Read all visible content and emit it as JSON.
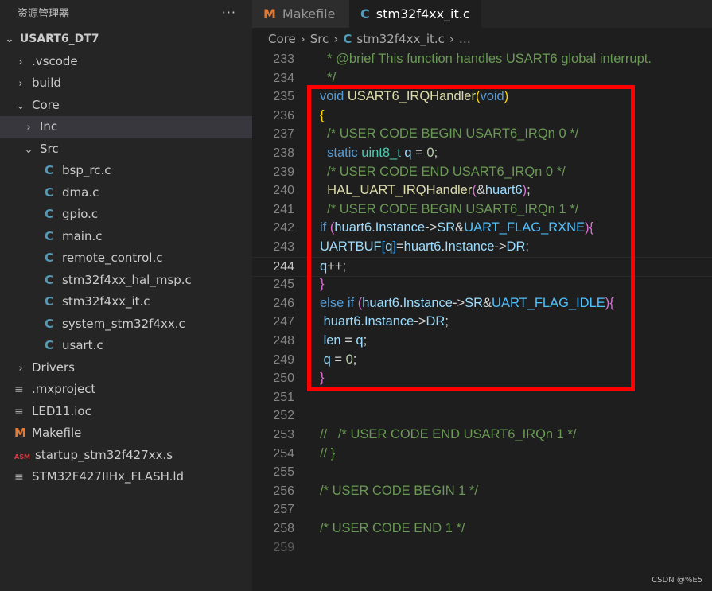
{
  "explorer": {
    "title": "资源管理器",
    "more": "···",
    "root": "USART6_DT7",
    "items": [
      {
        "label": ".vscode",
        "kind": "folder",
        "open": false,
        "depth": 1,
        "chev": "›"
      },
      {
        "label": "build",
        "kind": "folder",
        "open": false,
        "depth": 1,
        "chev": "›"
      },
      {
        "label": "Core",
        "kind": "folder",
        "open": true,
        "depth": 1,
        "chev": "⌄"
      },
      {
        "label": "Inc",
        "kind": "folder",
        "open": false,
        "depth": 2,
        "chev": "›",
        "selected": true
      },
      {
        "label": "Src",
        "kind": "folder",
        "open": true,
        "depth": 2,
        "chev": "⌄"
      },
      {
        "label": "bsp_rc.c",
        "kind": "c",
        "depth": 3
      },
      {
        "label": "dma.c",
        "kind": "c",
        "depth": 3
      },
      {
        "label": "gpio.c",
        "kind": "c",
        "depth": 3
      },
      {
        "label": "main.c",
        "kind": "c",
        "depth": 3
      },
      {
        "label": "remote_control.c",
        "kind": "c",
        "depth": 3
      },
      {
        "label": "stm32f4xx_hal_msp.c",
        "kind": "c",
        "depth": 3
      },
      {
        "label": "stm32f4xx_it.c",
        "kind": "c",
        "depth": 3
      },
      {
        "label": "system_stm32f4xx.c",
        "kind": "c",
        "depth": 3
      },
      {
        "label": "usart.c",
        "kind": "c",
        "depth": 3
      },
      {
        "label": "Drivers",
        "kind": "folder",
        "open": false,
        "depth": 1,
        "chev": "›"
      },
      {
        "label": ".mxproject",
        "kind": "lines",
        "depth": 1
      },
      {
        "label": "LED11.ioc",
        "kind": "lines",
        "depth": 1
      },
      {
        "label": "Makefile",
        "kind": "make",
        "depth": 1
      },
      {
        "label": "startup_stm32f427xx.s",
        "kind": "asm",
        "depth": 1
      },
      {
        "label": "STM32F427IIHx_FLASH.ld",
        "kind": "lines",
        "depth": 1
      }
    ],
    "icons": {
      "c": "C",
      "make": "M",
      "asm": "ASM",
      "lines": "≡"
    }
  },
  "tabs": [
    {
      "label": "Makefile",
      "icon": "M",
      "active": false
    },
    {
      "label": "stm32f4xx_it.c",
      "icon": "C",
      "active": true,
      "modified": true
    }
  ],
  "breadcrumb": {
    "parts": [
      "Core",
      "Src"
    ],
    "file_icon": "C",
    "file": "stm32f4xx_it.c",
    "tail": "…",
    "sep": "›"
  },
  "code": {
    "current_line": 244,
    "lines": [
      {
        "n": 233,
        "segs": [
          [
            "c",
            "  * @brief "
          ],
          [
            "c",
            "This function handles USART6 global interrupt."
          ]
        ]
      },
      {
        "n": 234,
        "segs": [
          [
            "c",
            "  */"
          ]
        ]
      },
      {
        "n": 235,
        "segs": [
          [
            "k",
            "void "
          ],
          [
            "f",
            "USART6_IRQHandler"
          ],
          [
            "p1",
            "("
          ],
          [
            "k",
            "void"
          ],
          [
            "p1",
            ")"
          ]
        ]
      },
      {
        "n": 236,
        "segs": [
          [
            "p1",
            "{"
          ]
        ]
      },
      {
        "n": 237,
        "segs": [
          [
            "c",
            "  /* USER CODE BEGIN USART6_IRQn 0 */"
          ]
        ]
      },
      {
        "n": 238,
        "segs": [
          [
            "k",
            "  static "
          ],
          [
            "t",
            "uint8_t "
          ],
          [
            "v",
            "q"
          ],
          [
            "d",
            " = "
          ],
          [
            "n",
            "0"
          ],
          [
            "d",
            ";"
          ]
        ]
      },
      {
        "n": 239,
        "segs": [
          [
            "c",
            "  /* USER CODE END USART6_IRQn 0 */"
          ]
        ]
      },
      {
        "n": 240,
        "segs": [
          [
            "f",
            "  HAL_UART_IRQHandler"
          ],
          [
            "p2",
            "("
          ],
          [
            "d",
            "&"
          ],
          [
            "v",
            "huart6"
          ],
          [
            "p2",
            ")"
          ],
          [
            "d",
            ";"
          ]
        ]
      },
      {
        "n": 241,
        "segs": [
          [
            "c",
            "  /* USER CODE BEGIN USART6_IRQn 1 */"
          ]
        ]
      },
      {
        "n": 242,
        "segs": [
          [
            "k",
            "if "
          ],
          [
            "p2",
            "("
          ],
          [
            "v",
            "huart6"
          ],
          [
            "d",
            "."
          ],
          [
            "v",
            "Instance"
          ],
          [
            "d",
            "->"
          ],
          [
            "v",
            "SR"
          ],
          [
            "d",
            "&"
          ],
          [
            "m",
            "UART_FLAG_RXNE"
          ],
          [
            "p2",
            ")"
          ],
          [
            "p2",
            "{"
          ]
        ]
      },
      {
        "n": 243,
        "segs": [
          [
            "v",
            "UARTBUF"
          ],
          [
            "p3",
            "["
          ],
          [
            "v",
            "q"
          ],
          [
            "p3",
            "]"
          ],
          [
            "d",
            "="
          ],
          [
            "v",
            "huart6"
          ],
          [
            "d",
            "."
          ],
          [
            "v",
            "Instance"
          ],
          [
            "d",
            "->"
          ],
          [
            "v",
            "DR"
          ],
          [
            "d",
            ";"
          ]
        ]
      },
      {
        "n": 244,
        "segs": [
          [
            "v",
            "q"
          ],
          [
            "d",
            "++;"
          ]
        ]
      },
      {
        "n": 245,
        "segs": [
          [
            "p2",
            "}"
          ]
        ]
      },
      {
        "n": 246,
        "segs": [
          [
            "k",
            "else if "
          ],
          [
            "p2",
            "("
          ],
          [
            "v",
            "huart6"
          ],
          [
            "d",
            "."
          ],
          [
            "v",
            "Instance"
          ],
          [
            "d",
            "->"
          ],
          [
            "v",
            "SR"
          ],
          [
            "d",
            "&"
          ],
          [
            "m",
            "UART_FLAG_IDLE"
          ],
          [
            "p2",
            ")"
          ],
          [
            "p2",
            "{"
          ]
        ]
      },
      {
        "n": 247,
        "segs": [
          [
            "v",
            " huart6"
          ],
          [
            "d",
            "."
          ],
          [
            "v",
            "Instance"
          ],
          [
            "d",
            "->"
          ],
          [
            "v",
            "DR"
          ],
          [
            "d",
            ";"
          ]
        ]
      },
      {
        "n": 248,
        "segs": [
          [
            "v",
            " len"
          ],
          [
            "d",
            " = "
          ],
          [
            "v",
            "q"
          ],
          [
            "d",
            ";"
          ]
        ]
      },
      {
        "n": 249,
        "segs": [
          [
            "v",
            " q"
          ],
          [
            "d",
            " = "
          ],
          [
            "n",
            "0"
          ],
          [
            "d",
            ";"
          ]
        ]
      },
      {
        "n": 250,
        "segs": [
          [
            "p2",
            "}"
          ]
        ]
      },
      {
        "n": 251,
        "segs": []
      },
      {
        "n": 252,
        "segs": []
      },
      {
        "n": 253,
        "segs": [
          [
            "c",
            "//   /* USER CODE END USART6_IRQn 1 */"
          ]
        ]
      },
      {
        "n": 254,
        "segs": [
          [
            "c",
            "// }"
          ]
        ]
      },
      {
        "n": 255,
        "segs": []
      },
      {
        "n": 256,
        "segs": [
          [
            "c",
            "/* USER CODE BEGIN 1 */"
          ]
        ]
      },
      {
        "n": 257,
        "segs": []
      },
      {
        "n": 258,
        "segs": [
          [
            "c",
            "/* USER CODE END 1 */"
          ]
        ]
      },
      {
        "n": 259,
        "segs": [],
        "faded": true
      }
    ]
  },
  "watermark": "CSDN @%E5"
}
